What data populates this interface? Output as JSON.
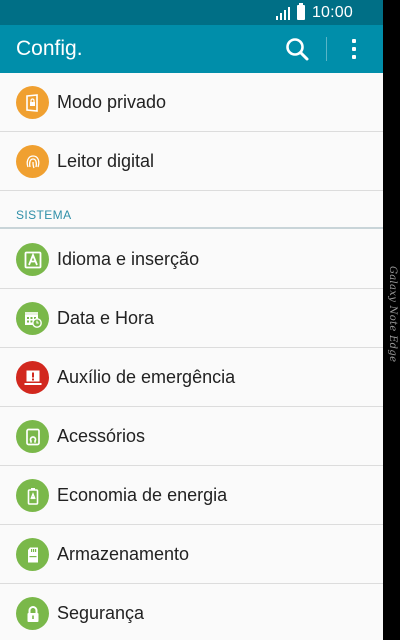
{
  "status_bar": {
    "time": "10:00"
  },
  "app_bar": {
    "title": "Config."
  },
  "section": {
    "title": "SISTEMA"
  },
  "edge_brand": "Galaxy Note Edge",
  "colors": {
    "status_bar": "#006f86",
    "app_bar": "#008eaa",
    "icon_orange": "#f0a030",
    "icon_green": "#7ab84a",
    "icon_red": "#d2281e",
    "section_text": "#2f8fa8"
  },
  "items": [
    {
      "label": "Modo privado",
      "icon": "private-mode-icon",
      "color": "#f0a030"
    },
    {
      "label": "Leitor digital",
      "icon": "fingerprint-icon",
      "color": "#f0a030"
    },
    {
      "label": "Idioma e inserção",
      "icon": "language-icon",
      "color": "#7ab84a"
    },
    {
      "label": "Data e Hora",
      "icon": "calendar-clock-icon",
      "color": "#7ab84a"
    },
    {
      "label": "Auxílio de emergência",
      "icon": "emergency-icon",
      "color": "#d2281e"
    },
    {
      "label": "Acessórios",
      "icon": "accessory-icon",
      "color": "#7ab84a"
    },
    {
      "label": "Economia de energia",
      "icon": "battery-saver-icon",
      "color": "#7ab84a"
    },
    {
      "label": "Armazenamento",
      "icon": "sd-card-icon",
      "color": "#7ab84a"
    },
    {
      "label": "Segurança",
      "icon": "lock-icon",
      "color": "#7ab84a"
    }
  ]
}
